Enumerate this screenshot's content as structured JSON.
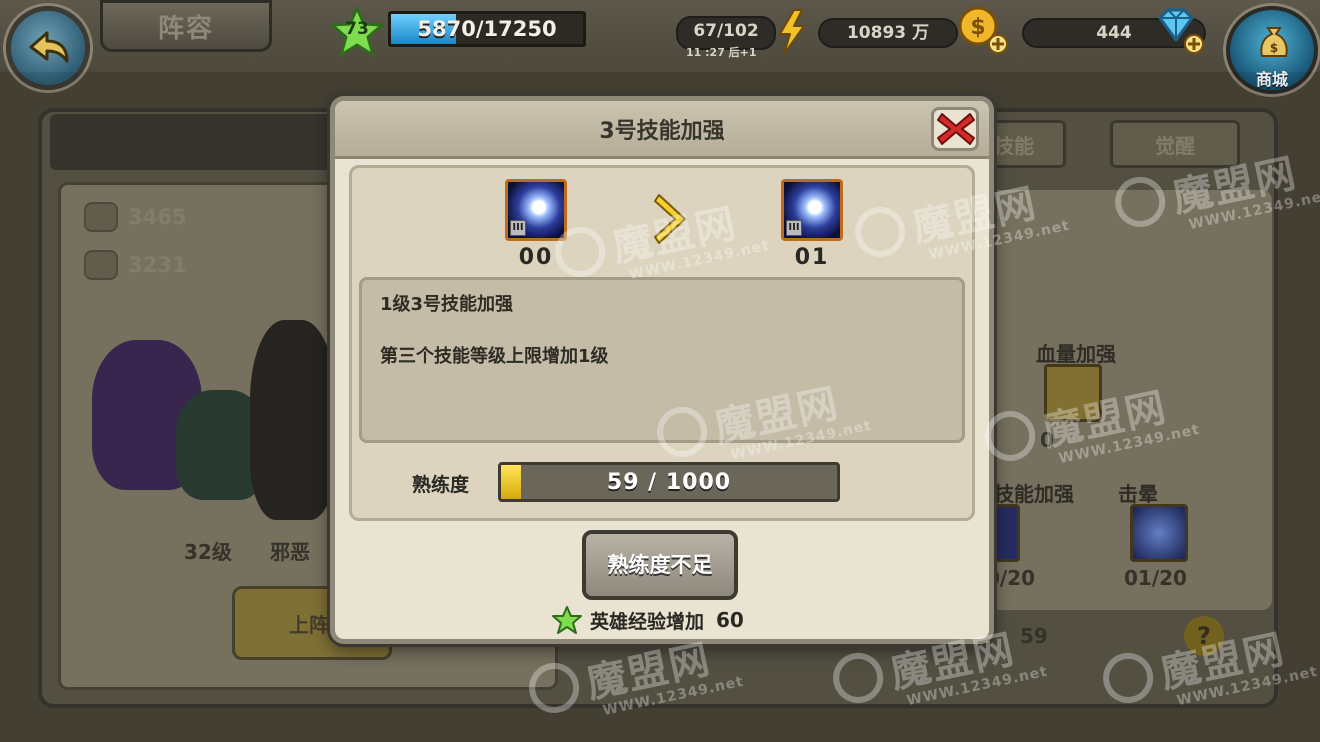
{
  "header": {
    "title": "阵容",
    "player_level": "73",
    "exp_text": "5870/17250",
    "exp_fraction": 0.34,
    "stamina": "67/102",
    "stamina_timer": "11 :27 后+1",
    "gold": "10893 万",
    "gems": "444",
    "shop_label": "商城"
  },
  "background": {
    "tab_partial": "技能",
    "tab_awaken": "觉醒",
    "attack": "3465",
    "defense": "3231",
    "hero_level": "32级",
    "hero_name_partial": "邪恶",
    "deploy_button_partial": "上阵",
    "skill_hp_label": "血量加强",
    "skill_hp_value_partial": "0",
    "skill_boost_label_partial": "技能加强",
    "skill_boost_value_partial": "0/20",
    "skill_stun_label": "击晕",
    "skill_stun_value": "01/20",
    "bottom_value_partial": "59",
    "help": "?"
  },
  "modal": {
    "title": "3号技能加强",
    "current_level": "00",
    "next_level": "01",
    "roman": "III",
    "desc_title": "1级3号技能加强",
    "desc_body": "第三个技能等级上限增加1级",
    "proficiency_label": "熟练度",
    "proficiency_text": "59 / 1000",
    "proficiency_fraction": 0.059,
    "action_button": "熟练度不足",
    "reward_label": "英雄经验增加",
    "reward_value": "60"
  },
  "watermark": {
    "text": "魔盟网",
    "url": "WWW.12349.net"
  },
  "colors": {
    "accent_gold": "#e6b817",
    "exp_blue": "#1a86c5",
    "modal_bg": "#e9e3d1",
    "close_red": "#d42a2a"
  }
}
